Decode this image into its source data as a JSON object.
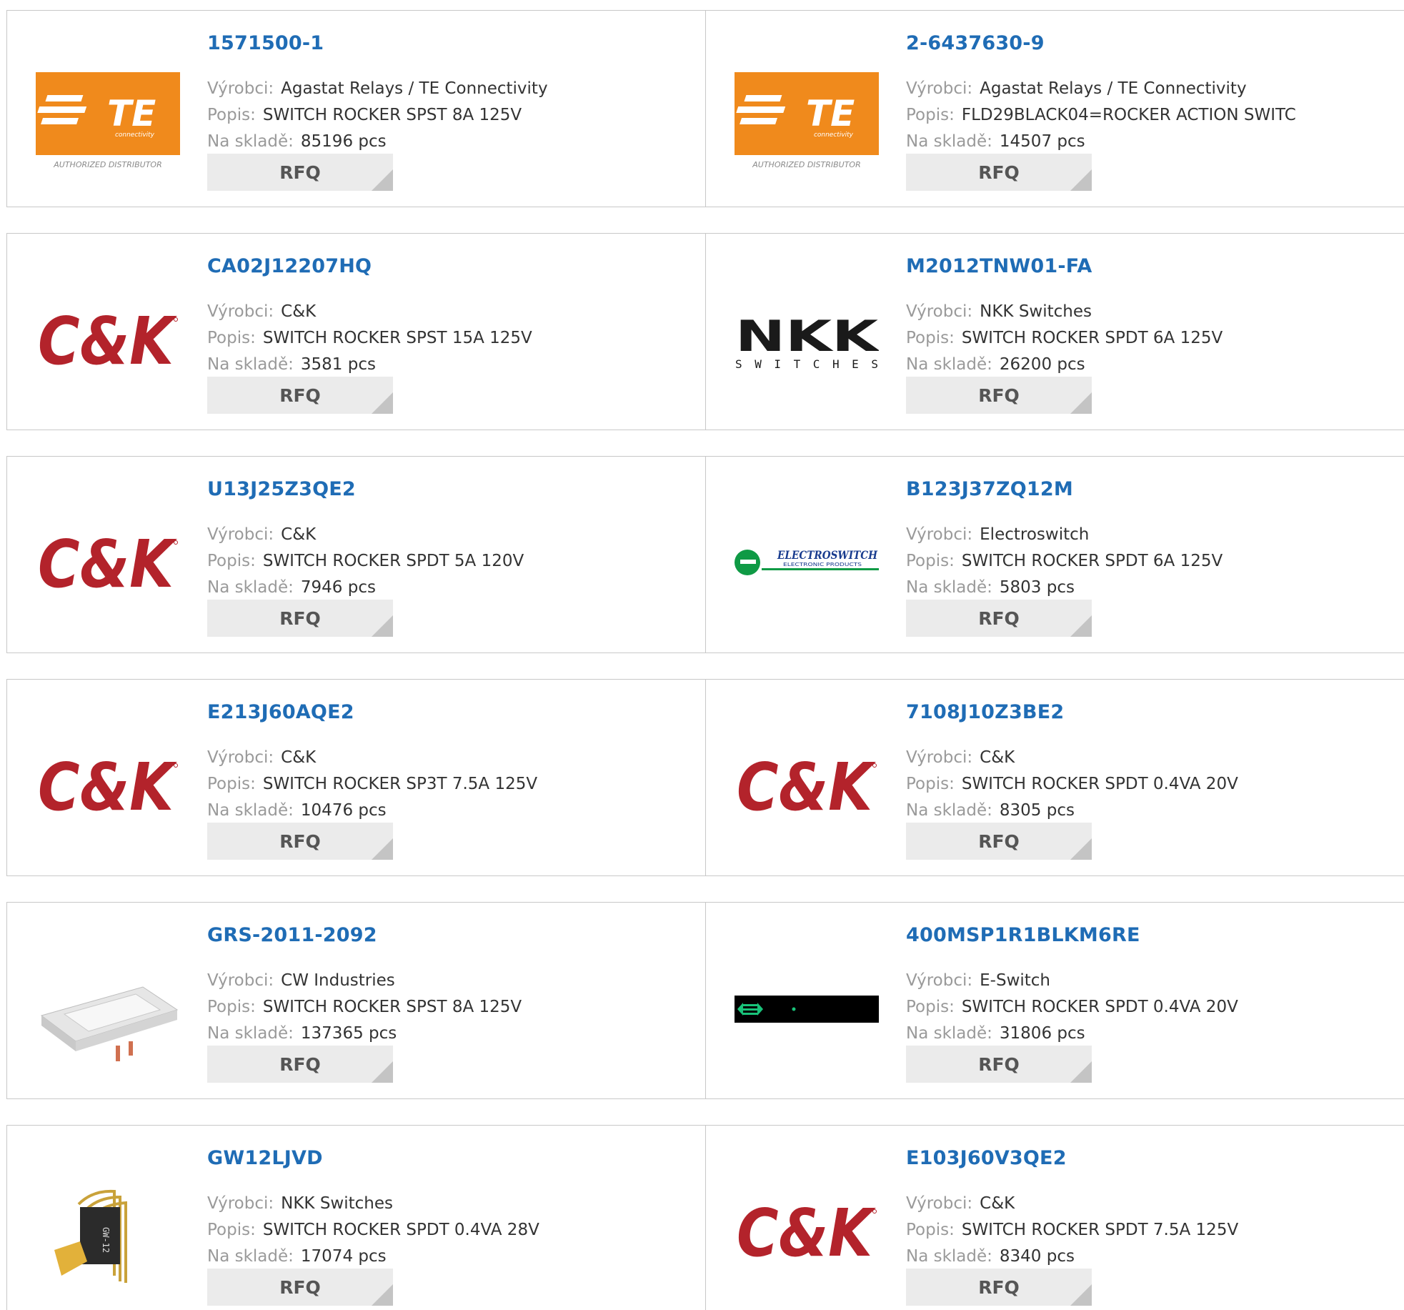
{
  "labels": {
    "manufacturer": "Výrobci:",
    "description": "Popis:",
    "stock": "Na skladě:",
    "rfq": "RFQ"
  },
  "products": [
    {
      "part": "1571500-1",
      "manufacturer": "Agastat Relays / TE Connectivity",
      "description": "SWITCH ROCKER SPST 8A 125V",
      "stock": "85196 pcs",
      "logo": "te",
      "logo_text": "TE",
      "logo_subtext": "connectivity",
      "logo_caption": "AUTHORIZED DISTRIBUTOR"
    },
    {
      "part": "2-6437630-9",
      "manufacturer": "Agastat Relays / TE Connectivity",
      "description": "FLD29BLACK04=ROCKER ACTION SWITC",
      "stock": "14507 pcs",
      "logo": "te",
      "logo_text": "TE",
      "logo_subtext": "connectivity",
      "logo_caption": "AUTHORIZED DISTRIBUTOR"
    },
    {
      "part": "CA02J12207HQ",
      "manufacturer": "C&K",
      "description": "SWITCH ROCKER SPST 15A 125V",
      "stock": "3581 pcs",
      "logo": "ck",
      "logo_text": "C&K"
    },
    {
      "part": "M2012TNW01-FA",
      "manufacturer": "NKK Switches",
      "description": "SWITCH ROCKER SPDT 6A 125V",
      "stock": "26200 pcs",
      "logo": "nkk",
      "logo_text": "NKK",
      "logo_subtext": "SWITCHES"
    },
    {
      "part": "U13J25Z3QE2",
      "manufacturer": "C&K",
      "description": "SWITCH ROCKER SPDT 5A 120V",
      "stock": "7946 pcs",
      "logo": "ck",
      "logo_text": "C&K"
    },
    {
      "part": "B123J37ZQ12M",
      "manufacturer": "Electroswitch",
      "description": "SWITCH ROCKER SPDT 6A 125V",
      "stock": "5803 pcs",
      "logo": "electroswitch",
      "logo_text": "ELECTROSWITCH",
      "logo_subtext": "ELECTRONIC PRODUCTS"
    },
    {
      "part": "E213J60AQE2",
      "manufacturer": "C&K",
      "description": "SWITCH ROCKER SP3T 7.5A 125V",
      "stock": "10476 pcs",
      "logo": "ck",
      "logo_text": "C&K"
    },
    {
      "part": "7108J10Z3BE2",
      "manufacturer": "C&K",
      "description": "SWITCH ROCKER SPDT 0.4VA 20V",
      "stock": "8305 pcs",
      "logo": "ck",
      "logo_text": "C&K"
    },
    {
      "part": "GRS-2011-2092",
      "manufacturer": "CW Industries",
      "description": "SWITCH ROCKER SPST 8A 125V",
      "stock": "137365 pcs",
      "logo": "rocker-photo"
    },
    {
      "part": "400MSP1R1BLKM6RE",
      "manufacturer": "E-Switch",
      "description": "SWITCH ROCKER SPDT 0.4VA 20V",
      "stock": "31806 pcs",
      "logo": "eswitch"
    },
    {
      "part": "GW12LJVD",
      "manufacturer": "NKK Switches",
      "description": "SWITCH ROCKER SPDT 0.4VA 28V",
      "stock": "17074 pcs",
      "logo": "toggle-photo",
      "logo_text": "GW-12"
    },
    {
      "part": "E103J60V3QE2",
      "manufacturer": "C&K",
      "description": "SWITCH ROCKER SPDT 7.5A 125V",
      "stock": "8340 pcs",
      "logo": "ck",
      "logo_text": "C&K"
    }
  ]
}
